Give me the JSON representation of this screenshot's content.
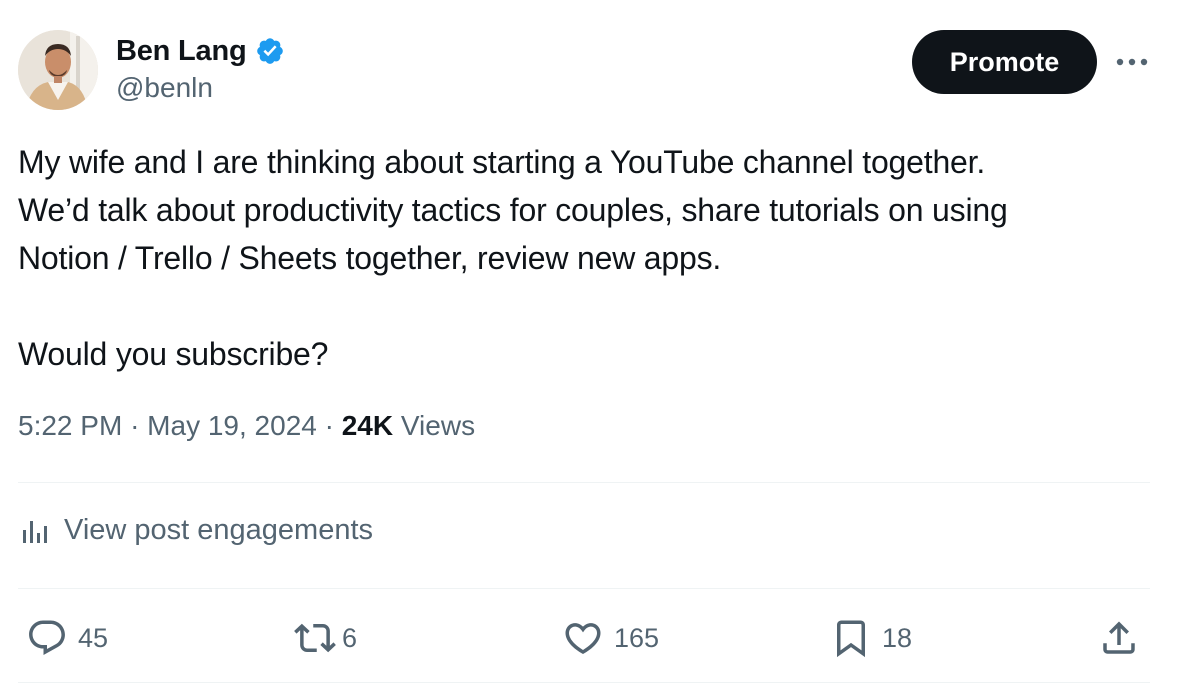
{
  "author": {
    "display_name": "Ben Lang",
    "handle": "@benln",
    "verified": true,
    "verified_color": "#1d9bf0"
  },
  "header": {
    "promote_label": "Promote"
  },
  "post": {
    "text": "My wife and I are thinking about starting a YouTube channel together.\nWe’d talk about productivity tactics for couples, share tutorials on using\nNotion / Trello / Sheets together, review new apps.\n\nWould you subscribe?",
    "time": "5:22 PM",
    "date": "May 19, 2024",
    "separator": "·",
    "views_count": "24K",
    "views_label": "Views"
  },
  "engagements": {
    "label": "View post engagements",
    "icon": "bar-chart-icon"
  },
  "actions": {
    "replies": "45",
    "reposts": "6",
    "likes": "165",
    "bookmarks": "18"
  },
  "colors": {
    "text_primary": "#0f1419",
    "text_secondary": "#536471",
    "divider": "#eff3f4",
    "button_bg": "#0f1419"
  }
}
